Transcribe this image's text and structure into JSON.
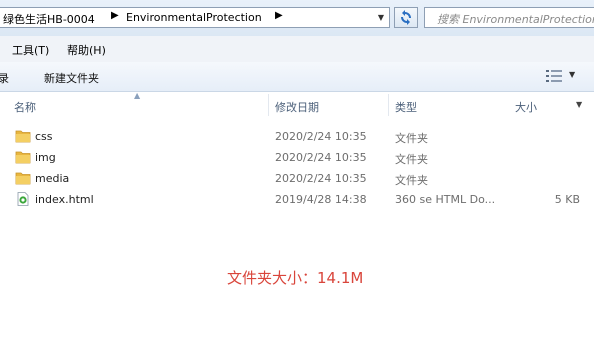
{
  "address_bar": {
    "crumbs": [
      "绿色生活HB-0004",
      "EnvironmentalProtection"
    ],
    "search_placeholder": "搜索 EnvironmentalProtection"
  },
  "menu": {
    "items": [
      "工具(T)",
      "帮助(H)"
    ]
  },
  "toolbar": {
    "partial_left": "录",
    "new_folder": "新建文件夹"
  },
  "columns": {
    "name": "名称",
    "date_modified": "修改日期",
    "type": "类型",
    "size": "大小"
  },
  "files": [
    {
      "name": "css",
      "date": "2020/2/24 10:35",
      "type": "文件夹",
      "size": "",
      "icon": "folder-icon"
    },
    {
      "name": "img",
      "date": "2020/2/24 10:35",
      "type": "文件夹",
      "size": "",
      "icon": "folder-icon"
    },
    {
      "name": "media",
      "date": "2020/2/24 10:35",
      "type": "文件夹",
      "size": "",
      "icon": "folder-icon"
    },
    {
      "name": "index.html",
      "date": "2019/4/28 14:38",
      "type": "360 se HTML Do...",
      "size": "5 KB",
      "icon": "html-file-icon"
    }
  ],
  "overlay": {
    "folder_size_label": "文件夹大小：14.1M"
  },
  "colors": {
    "overlay_text": "#d9453b",
    "header_text": "#4c607a",
    "folder_yellow": "#e8b640"
  }
}
